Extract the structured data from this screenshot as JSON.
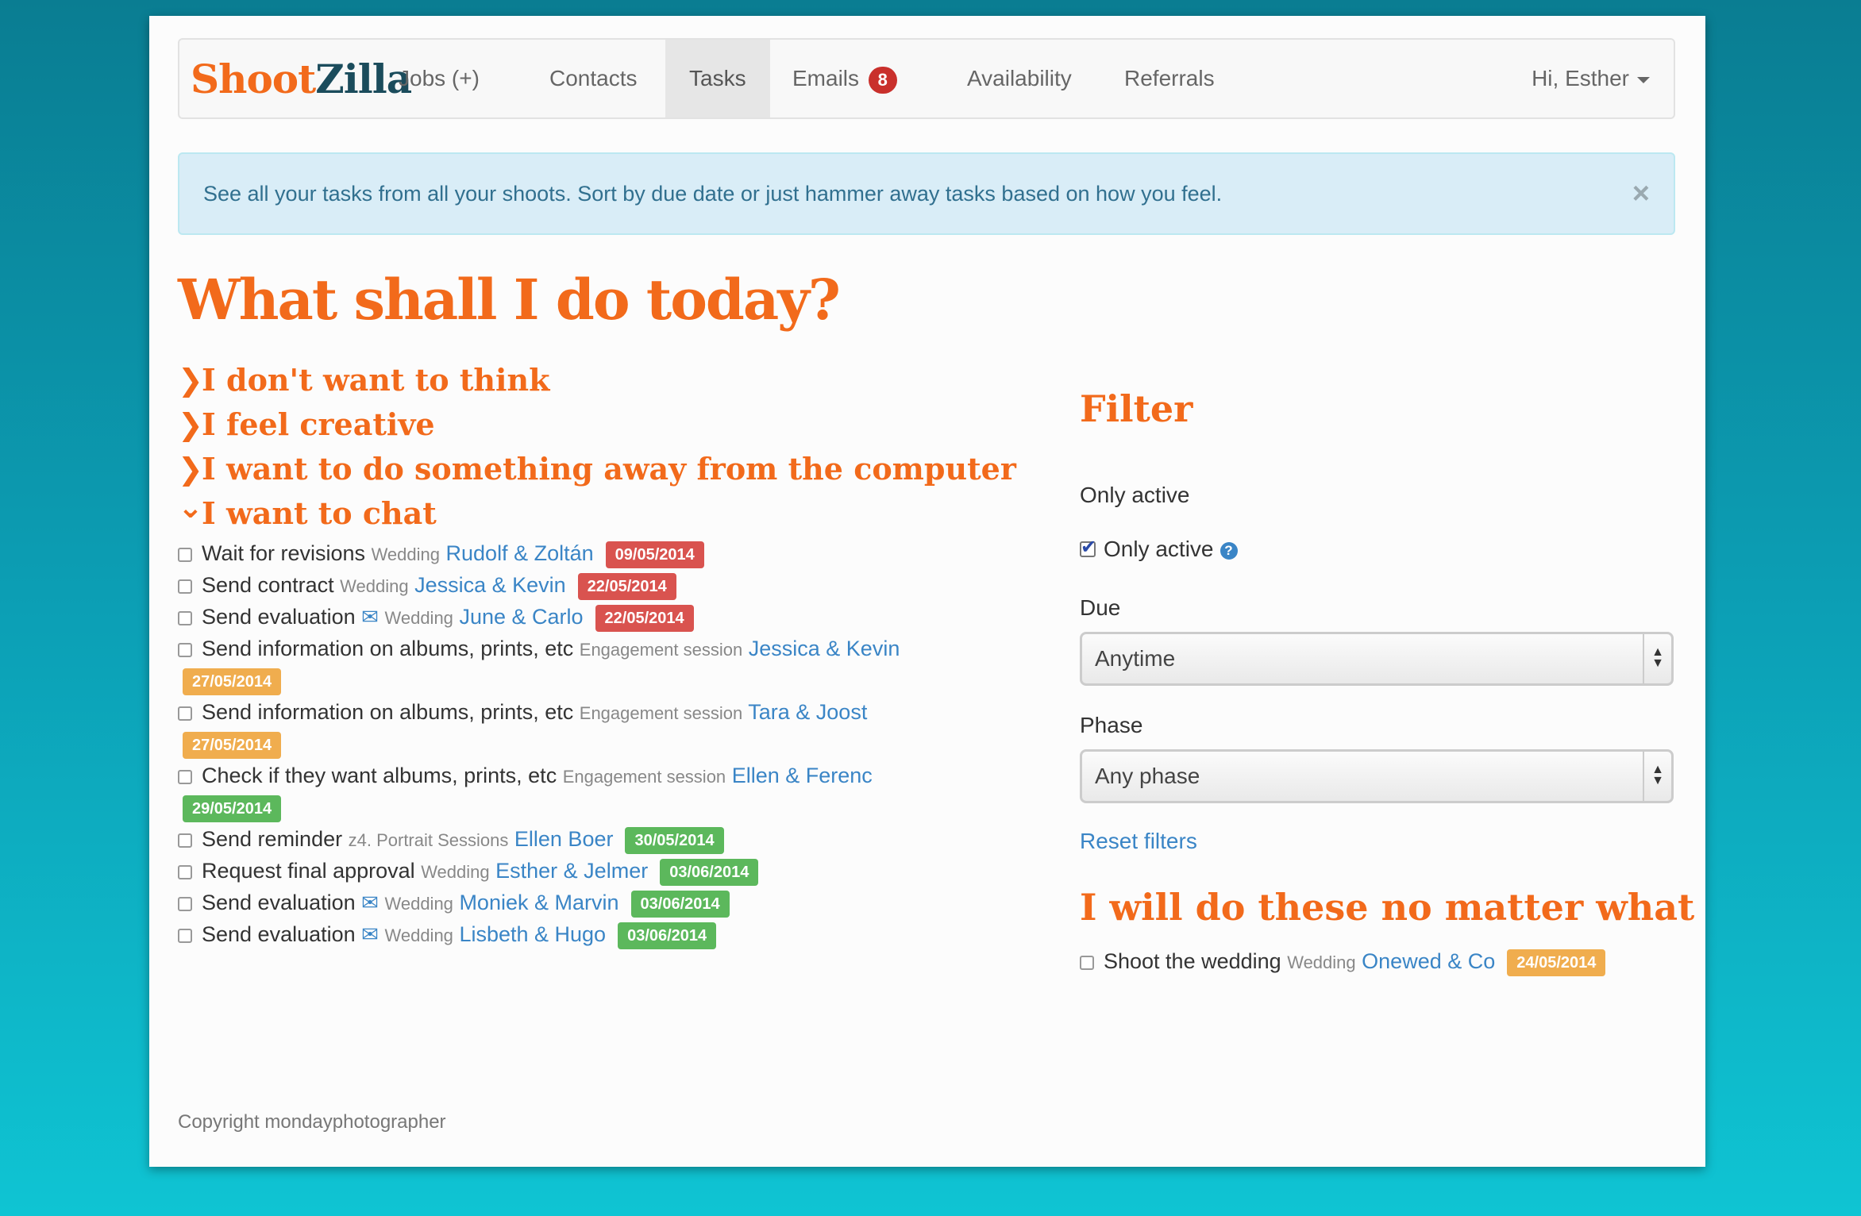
{
  "brand": {
    "part1": "Shoot",
    "part2": "Zilla"
  },
  "nav": {
    "items": [
      {
        "label": "Jobs (+)"
      },
      {
        "label": "Contacts"
      },
      {
        "label": "Tasks"
      },
      {
        "label": "Emails"
      },
      {
        "label": "Availability"
      },
      {
        "label": "Referrals"
      }
    ],
    "emails_badge": "8",
    "user_menu": "Hi, Esther"
  },
  "alert": {
    "text": "See all your tasks from all your shoots. Sort by due date or just hammer away tasks based on how you feel.",
    "close": "×"
  },
  "main": {
    "title": "What shall I do today?",
    "categories": [
      {
        "chevron": "❯",
        "label": "I don't want to think"
      },
      {
        "chevron": "❯",
        "label": "I feel creative"
      },
      {
        "chevron": "❯",
        "label": "I want to do something away from the computer"
      },
      {
        "chevron": "⌄",
        "label": "I want to chat"
      }
    ],
    "tasks": [
      {
        "name": "Wait for revisions",
        "type": "Wedding",
        "client": "Rudolf & Zoltán",
        "date": "09/05/2014",
        "status": "overdue"
      },
      {
        "name": "Send contract",
        "type": "Wedding",
        "client": "Jessica & Kevin",
        "date": "22/05/2014",
        "status": "overdue"
      },
      {
        "name": "Send evaluation",
        "type": "Wedding",
        "client": "June & Carlo",
        "date": "22/05/2014",
        "status": "overdue",
        "email_icon": "envelope-icon"
      },
      {
        "name": "Send information on albums, prints, etc",
        "type": "Engagement session",
        "client": "Jessica & Kevin",
        "date": "27/05/2014",
        "status": "soon"
      },
      {
        "name": "Send information on albums, prints, etc",
        "type": "Engagement session",
        "client": "Tara & Joost",
        "date": "27/05/2014",
        "status": "soon"
      },
      {
        "name": "Check if they want albums, prints, etc",
        "type": "Engagement session",
        "client": "Ellen & Ferenc",
        "date": "29/05/2014",
        "status": "later"
      },
      {
        "name": "Send reminder",
        "type": "z4. Portrait Sessions",
        "client": "Ellen Boer",
        "date": "30/05/2014",
        "status": "later"
      },
      {
        "name": "Request final approval",
        "type": "Wedding",
        "client": "Esther & Jelmer",
        "date": "03/06/2014",
        "status": "later"
      },
      {
        "name": "Send evaluation",
        "type": "Wedding",
        "client": "Moniek & Marvin",
        "date": "03/06/2014",
        "status": "later",
        "email_icon": "envelope-icon"
      },
      {
        "name": "Send evaluation",
        "type": "Wedding",
        "client": "Lisbeth & Hugo",
        "date": "03/06/2014",
        "status": "later",
        "email_icon": "envelope-icon"
      }
    ]
  },
  "filter": {
    "title": "Filter",
    "only_active_heading": "Only active",
    "only_active_label": "Only active",
    "only_active_checked": true,
    "help": "?",
    "due_label": "Due",
    "due_value": "Anytime",
    "phase_label": "Phase",
    "phase_value": "Any phase",
    "reset": "Reset filters"
  },
  "no_matter": {
    "title": "I will do these no matter what",
    "task": {
      "name": "Shoot the wedding",
      "type": "Wedding",
      "client": "Onewed & Co",
      "date": "24/05/2014",
      "status": "soon"
    }
  },
  "footer": {
    "text": "Copyright mondayphotographer"
  },
  "colors": {
    "accent": "#f26a1b",
    "link": "#3a85c6",
    "overdue": "#d9534f",
    "soon": "#f0ad4e",
    "later": "#5cb85c"
  },
  "icons": {
    "envelope": "✉",
    "up_down": "▲▼"
  }
}
